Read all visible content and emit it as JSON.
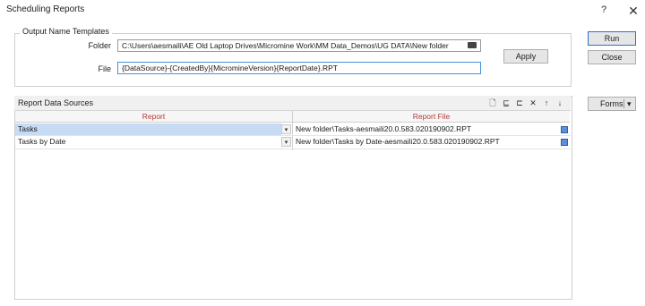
{
  "window": {
    "title": "Scheduling Reports",
    "help_glyph": "?",
    "close_glyph": "✕"
  },
  "output_templates": {
    "group_label": "Output Name Templates",
    "folder_label": "Folder",
    "folder_value": "C:\\Users\\aesmaili\\AE Old Laptop Drives\\Micromine Work\\MM Data_Demos\\UG DATA\\New folder",
    "file_label": "File",
    "file_value": "{DataSource}-{CreatedBy}{MicromineVersion}{ReportDate}.RPT",
    "apply_label": "Apply"
  },
  "side_buttons": {
    "run_label": "Run",
    "close_label": "Close",
    "forms_label": "Forms",
    "forms_arrow": "▾"
  },
  "data_sources": {
    "title": "Report Data Sources",
    "toolbar_icons": [
      "new-icon",
      "insert-row-icon",
      "append-row-icon",
      "delete-icon",
      "move-up-icon",
      "move-down-icon"
    ],
    "toolbar_glyphs": [
      "🗋",
      "⊑",
      "⊏",
      "✕",
      "↑",
      "↓"
    ],
    "columns": [
      "Report",
      "Report File"
    ],
    "rows": [
      {
        "report": "Tasks",
        "report_file": "New folder\\Tasks-aesmaili20.0.583.020190902.RPT",
        "selected": true
      },
      {
        "report": "Tasks by Date",
        "report_file": "New folder\\Tasks by Date-aesmaili20.0.583.020190902.RPT",
        "selected": false
      }
    ],
    "dropdown_glyph": "▾"
  },
  "colors": {
    "accent": "#2f6fc9",
    "selection": "#c7dbf5",
    "header_text": "#b23a3a"
  }
}
